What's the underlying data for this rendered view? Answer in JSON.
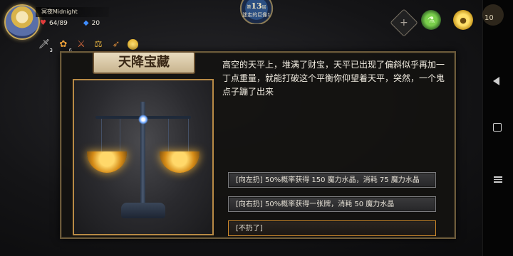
{
  "hero": {
    "name": "冥夜Midnight",
    "hp": "64/89",
    "mana": "20"
  },
  "inventory": [
    {
      "icon": "dagger-icon",
      "count": "3"
    },
    {
      "icon": "flower-icon",
      "count": "6"
    },
    {
      "icon": "sword-icon",
      "count": ""
    },
    {
      "icon": "scales-icon",
      "count": ""
    },
    {
      "icon": "torch-icon",
      "count": ""
    },
    {
      "icon": "gold-orb-icon",
      "count": ""
    }
  ],
  "floor": {
    "prefix": "第",
    "number": "13",
    "suffix": "层",
    "subtitle": "迷走的巨像1"
  },
  "top_right": {
    "coin_count": "10"
  },
  "event": {
    "title": "天降宝藏",
    "text": "高空的天平上，堆满了财宝，天平已出现了偏斜似乎再加一丁点重量，就能打破这个平衡你仰望着天平，突然，一个鬼点子蹦了出来",
    "options": [
      "[向左扔] 50%概率获得 150 魔力水晶，消耗 75 魔力水晶",
      "[向右扔] 50%概率获得一张牌，消耗 50 魔力水晶",
      "[不扔了]"
    ]
  },
  "colors": {
    "panel_border": "#6b5a3a",
    "art_border": "#b88a45",
    "selected_option_border": "#d08a2a"
  }
}
